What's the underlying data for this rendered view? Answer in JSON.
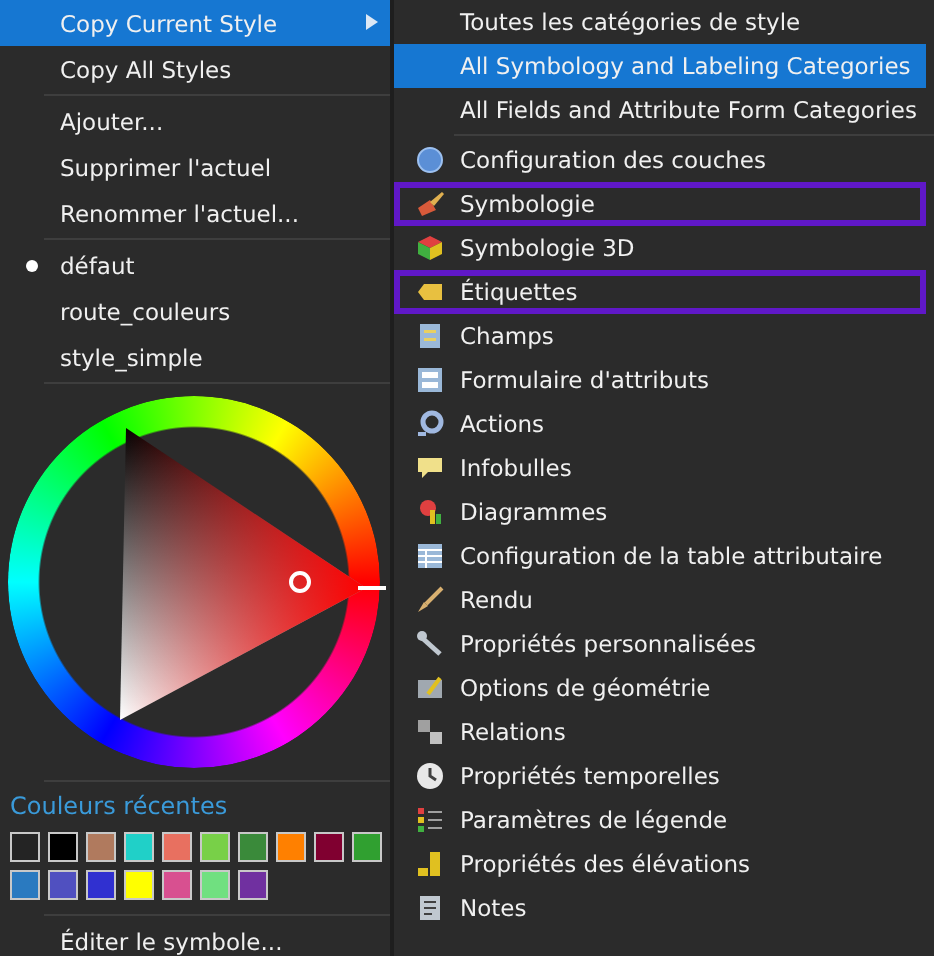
{
  "left_menu": {
    "groups": [
      [
        {
          "label": "Copy Current Style",
          "selected": true,
          "submenu": true
        },
        {
          "label": "Copy All Styles",
          "selected": false,
          "submenu": false
        }
      ],
      [
        {
          "label": "Ajouter...",
          "selected": false,
          "submenu": false
        },
        {
          "label": "Supprimer l'actuel",
          "selected": false,
          "submenu": false
        },
        {
          "label": "Renommer l'actuel...",
          "selected": false,
          "submenu": false
        }
      ]
    ],
    "styles": [
      {
        "label": "défaut",
        "current": true
      },
      {
        "label": "route_couleurs",
        "current": false
      },
      {
        "label": "style_simple",
        "current": false
      }
    ],
    "recent_colors": {
      "title": "Couleurs récentes",
      "swatches": [
        {
          "color": "#242424"
        },
        {
          "color": "#000000"
        },
        {
          "color": "#b07a5e"
        },
        {
          "color": "#20d0c8"
        },
        {
          "color": "#e87060"
        },
        {
          "color": "#78d048"
        },
        {
          "color": "#3a8a3a"
        },
        {
          "color": "#ff8000"
        },
        {
          "color": "#800030"
        },
        {
          "color": "#30a030"
        },
        {
          "color": "#2a7ac0"
        },
        {
          "color": "#5050c0"
        },
        {
          "color": "#3030d0"
        },
        {
          "color": "#ffff00"
        },
        {
          "color": "#d85090"
        },
        {
          "color": "#70e080"
        },
        {
          "color": "#7030a0"
        }
      ]
    },
    "edit_symbol": "Éditer le symbole..."
  },
  "submenu": {
    "items": [
      {
        "kind": "plain",
        "label": "Toutes les catégories de style",
        "selected": false,
        "highlighted": false
      },
      {
        "kind": "plain",
        "label": "All Symbology and Labeling Categories",
        "selected": true,
        "highlighted": false
      },
      {
        "kind": "plain",
        "label": "All Fields and Attribute Form Categories",
        "selected": false,
        "highlighted": false
      },
      {
        "kind": "separator"
      },
      {
        "kind": "category",
        "label": "Configuration des couches",
        "selected": false,
        "highlighted": false
      },
      {
        "kind": "category",
        "label": "Symbologie",
        "selected": false,
        "highlighted": true
      },
      {
        "kind": "category",
        "label": "Symbologie 3D",
        "selected": false,
        "highlighted": false
      },
      {
        "kind": "category",
        "label": "Étiquettes",
        "selected": false,
        "highlighted": true
      },
      {
        "kind": "category",
        "label": "Champs",
        "selected": false,
        "highlighted": false
      },
      {
        "kind": "category",
        "label": "Formulaire d'attributs",
        "selected": false,
        "highlighted": false
      },
      {
        "kind": "category",
        "label": "Actions",
        "selected": false,
        "highlighted": false
      },
      {
        "kind": "category",
        "label": "Infobulles",
        "selected": false,
        "highlighted": false
      },
      {
        "kind": "category",
        "label": "Diagrammes",
        "selected": false,
        "highlighted": false
      },
      {
        "kind": "category",
        "label": "Configuration de la table attributaire",
        "selected": false,
        "highlighted": false
      },
      {
        "kind": "category",
        "label": "Rendu",
        "selected": false,
        "highlighted": false
      },
      {
        "kind": "category",
        "label": "Propriétés personnalisées",
        "selected": false,
        "highlighted": false
      },
      {
        "kind": "category",
        "label": "Options de géométrie",
        "selected": false,
        "highlighted": false
      },
      {
        "kind": "category",
        "label": "Relations",
        "selected": false,
        "highlighted": false
      },
      {
        "kind": "category",
        "label": "Propriétés temporelles",
        "selected": false,
        "highlighted": false
      },
      {
        "kind": "category",
        "label": "Paramètres de légende",
        "selected": false,
        "highlighted": false
      },
      {
        "kind": "category",
        "label": "Propriétés des élévations",
        "selected": false,
        "highlighted": false
      },
      {
        "kind": "category",
        "label": "Notes",
        "selected": false,
        "highlighted": false
      }
    ]
  }
}
